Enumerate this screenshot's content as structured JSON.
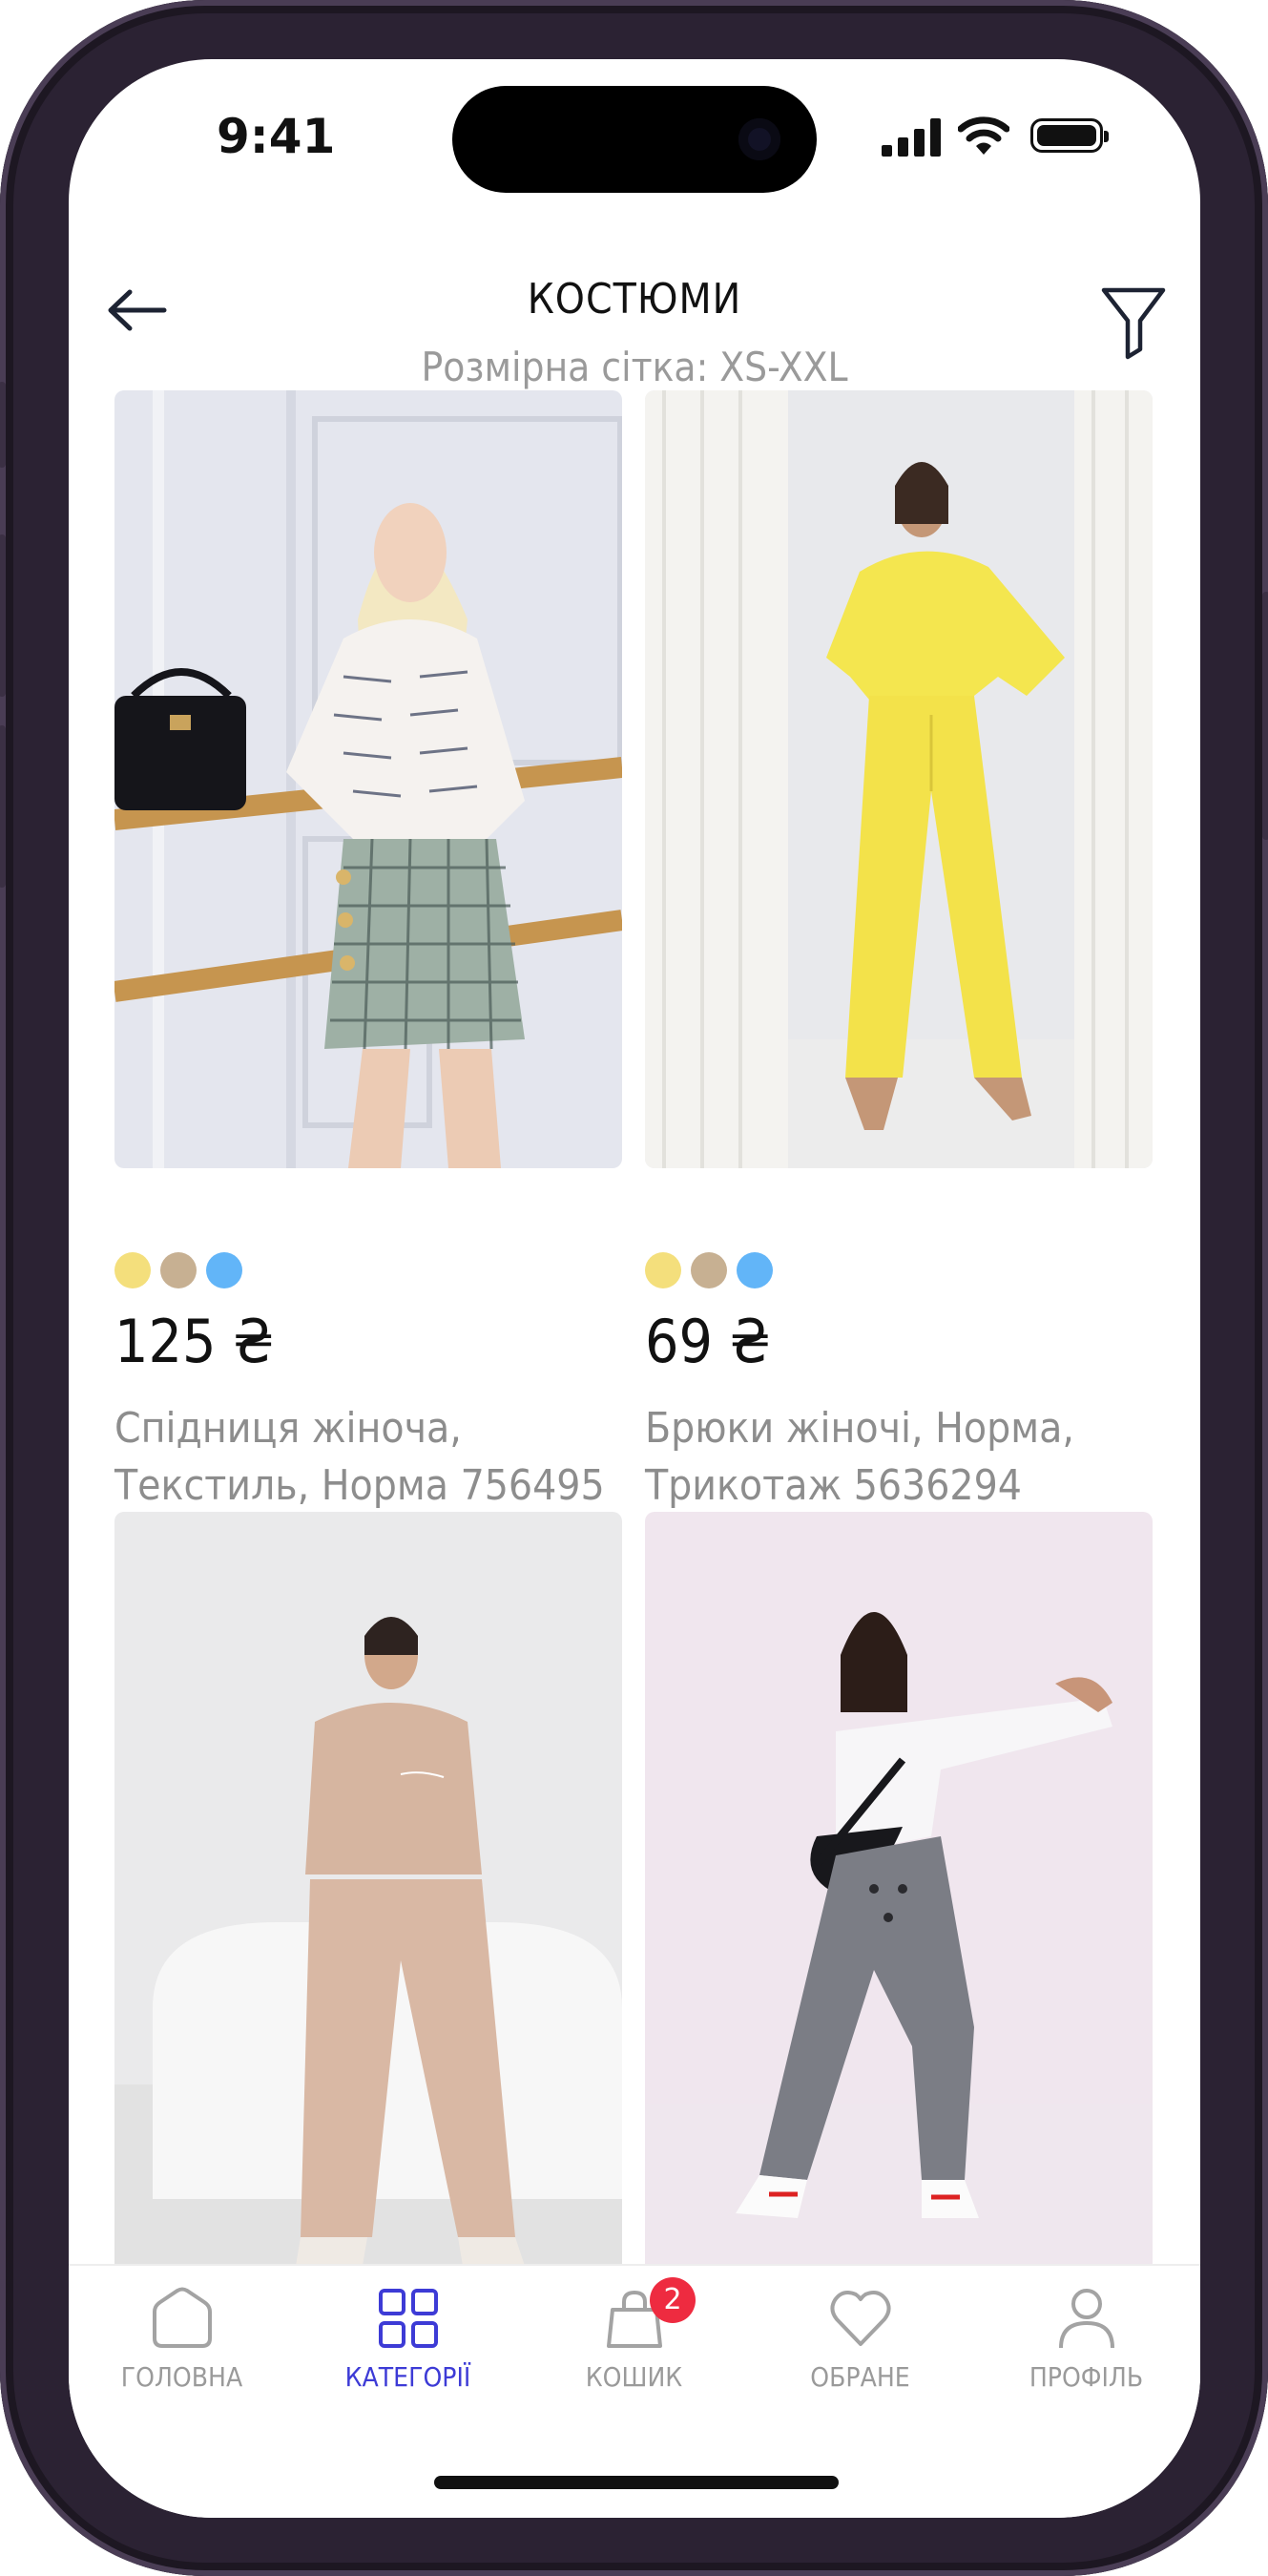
{
  "status_bar": {
    "time": "9:41"
  },
  "header": {
    "title": "КОСТЮМИ",
    "subtitle": "Розмірна сітка: XS-XXL"
  },
  "products": [
    {
      "price": "125 ₴",
      "description": "Спідниця жіноча, Текстиль, Норма 756495",
      "swatches": [
        "#f4df7c",
        "#c7b092",
        "#62b5f8"
      ]
    },
    {
      "price": "69 ₴",
      "description": "Брюки жіночі, Норма, Трикотаж 5636294",
      "swatches": [
        "#f4df7c",
        "#c7b092",
        "#62b5f8"
      ]
    },
    {
      "price": "",
      "description": "",
      "swatches": []
    },
    {
      "price": "",
      "description": "",
      "swatches": []
    }
  ],
  "tab_bar": {
    "items": [
      {
        "label": "ГОЛОВНА",
        "icon": "home-icon"
      },
      {
        "label": "КАТЕГОРІЇ",
        "icon": "grid-icon",
        "active": true
      },
      {
        "label": "КОШИК",
        "icon": "bag-icon",
        "badge": "2"
      },
      {
        "label": "ОБРАНЕ",
        "icon": "heart-icon"
      },
      {
        "label": "ПРОФІЛЬ",
        "icon": "user-icon"
      }
    ]
  },
  "colors": {
    "accent": "#3d3bd6",
    "badge": "#ee2b40",
    "muted_text": "#9a9a9a"
  }
}
